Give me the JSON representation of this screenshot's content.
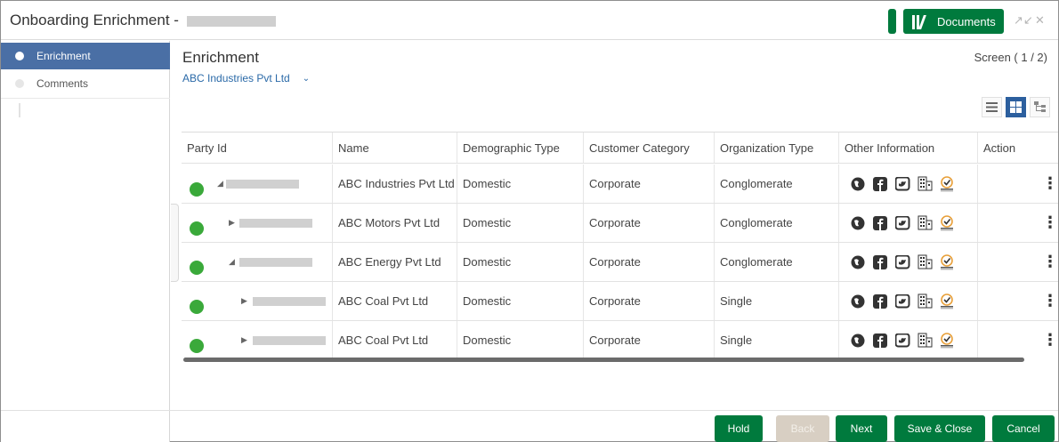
{
  "window": {
    "title": "Onboarding Enrichment -",
    "documents_label": "Documents",
    "minimize_glyph": "↗↙",
    "close_glyph": "✕"
  },
  "sidebar": {
    "items": [
      {
        "label": "Enrichment",
        "active": true
      },
      {
        "label": "Comments",
        "active": false
      }
    ]
  },
  "main": {
    "title": "Enrichment",
    "screen_count": "Screen ( 1 / 2)",
    "company": "ABC Industries Pvt Ltd"
  },
  "table": {
    "columns": [
      "Party Id",
      "Name",
      "Demographic Type",
      "Customer Category",
      "Organization Type",
      "Other Information",
      "Action"
    ],
    "rows": [
      {
        "name": "ABC Industries Pvt Ltd",
        "demographic": "Domestic",
        "category": "Corporate",
        "org_type": "Conglomerate",
        "expanded": true,
        "level": 0
      },
      {
        "name": "ABC Motors Pvt Ltd",
        "demographic": "Domestic",
        "category": "Corporate",
        "org_type": "Conglomerate",
        "expanded": false,
        "level": 1
      },
      {
        "name": "ABC Energy Pvt Ltd",
        "demographic": "Domestic",
        "category": "Corporate",
        "org_type": "Conglomerate",
        "expanded": true,
        "level": 1
      },
      {
        "name": "ABC Coal Pvt Ltd",
        "demographic": "Domestic",
        "category": "Corporate",
        "org_type": "Single",
        "expanded": false,
        "level": 2
      },
      {
        "name": "ABC Coal Pvt Ltd",
        "demographic": "Domestic",
        "category": "Corporate",
        "org_type": "Single",
        "expanded": false,
        "level": 2
      }
    ],
    "info_icons": [
      "globe-icon",
      "facebook-icon",
      "twitter-icon",
      "building-icon",
      "rating-icon"
    ],
    "status_color": "#3aa93a"
  },
  "footer": {
    "hold": "Hold",
    "back": "Back",
    "next": "Next",
    "save_close": "Save & Close",
    "cancel": "Cancel"
  },
  "colors": {
    "primary_green": "#007a3d",
    "sidebar_active": "#4a6fa5",
    "link_blue": "#2b6aa8"
  }
}
